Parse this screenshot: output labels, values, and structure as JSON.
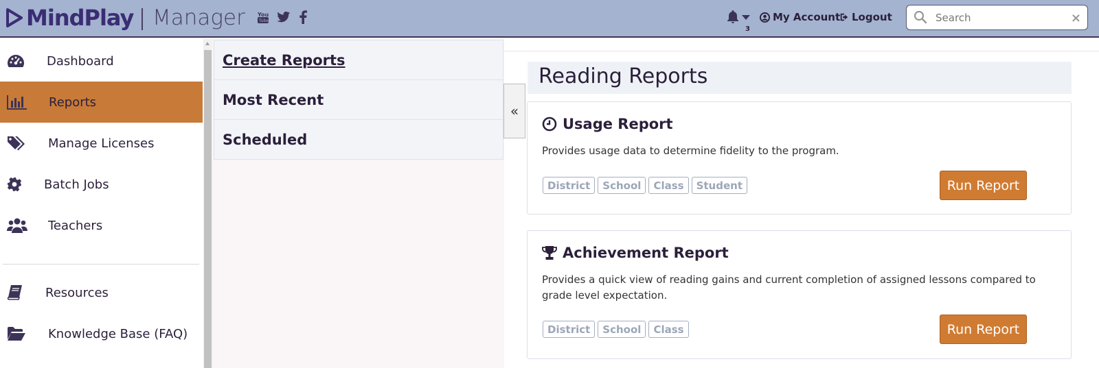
{
  "header": {
    "brand": "MindPlay",
    "product": "Manager",
    "social_icons": [
      "youtube-icon",
      "twitter-icon",
      "facebook-icon"
    ],
    "notification_count": "3",
    "account_label": "My Account",
    "logout_label": "Logout",
    "search_placeholder": "Search",
    "search_clear": "×"
  },
  "sidebar": {
    "items": [
      {
        "label": "Dashboard",
        "icon": "dashboard-icon",
        "active": false
      },
      {
        "label": "Reports",
        "icon": "bar-chart-icon",
        "active": true
      },
      {
        "label": "Manage Licenses",
        "icon": "tags-icon",
        "active": false
      },
      {
        "label": "Batch Jobs",
        "icon": "gear-icon",
        "active": false
      },
      {
        "label": "Teachers",
        "icon": "users-icon",
        "active": false
      },
      {
        "label": "Resources",
        "icon": "book-icon",
        "active": false
      },
      {
        "label": "Knowledge Base (FAQ)",
        "icon": "folder-open-icon",
        "active": false
      }
    ]
  },
  "submenu": {
    "items": [
      "Create Reports",
      "Most Recent",
      "Scheduled"
    ],
    "collapse_label": "«"
  },
  "main": {
    "section_title": "Reading Reports",
    "cards": [
      {
        "icon": "clock-icon",
        "title": "Usage Report",
        "description": "Provides usage data to determine fidelity to the program.",
        "tags": [
          "District",
          "School",
          "Class",
          "Student"
        ],
        "button": "Run Report"
      },
      {
        "icon": "trophy-icon",
        "title": "Achievement Report",
        "description": "Provides a quick view of reading gains and current completion of assigned lessons compared to grade level expectation.",
        "tags": [
          "District",
          "School",
          "Class"
        ],
        "button": "Run Report"
      }
    ]
  },
  "colors": {
    "header_bg": "#a3b3d0",
    "brand": "#3b2d73",
    "active_nav": "#c87a38",
    "run_button": "#d07b32"
  }
}
